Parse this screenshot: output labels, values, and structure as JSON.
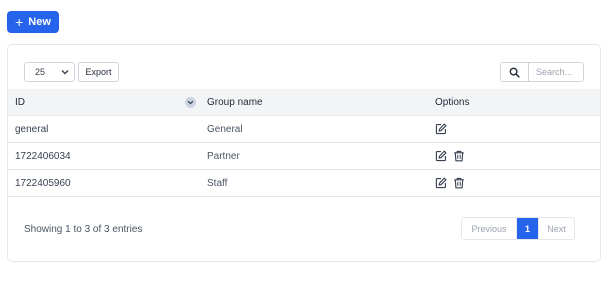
{
  "toolbar": {
    "new_label": "New"
  },
  "table_controls": {
    "page_length": "25",
    "export_label": "Export",
    "search_placeholder": "Search..."
  },
  "table": {
    "columns": [
      "ID",
      "Group name",
      "Options"
    ],
    "rows": [
      {
        "id": "general",
        "name": "General",
        "options": [
          "edit"
        ]
      },
      {
        "id": "1722406034",
        "name": "Partner",
        "options": [
          "edit",
          "delete"
        ]
      },
      {
        "id": "1722405960",
        "name": "Staff",
        "options": [
          "edit",
          "delete"
        ]
      }
    ]
  },
  "footer": {
    "info": "Showing 1 to 3 of 3 entries",
    "prev_label": "Previous",
    "current_page": "1",
    "next_label": "Next"
  },
  "colors": {
    "primary": "#2563eb",
    "header_bg": "#f3f4f6",
    "border": "#e5e7eb"
  }
}
